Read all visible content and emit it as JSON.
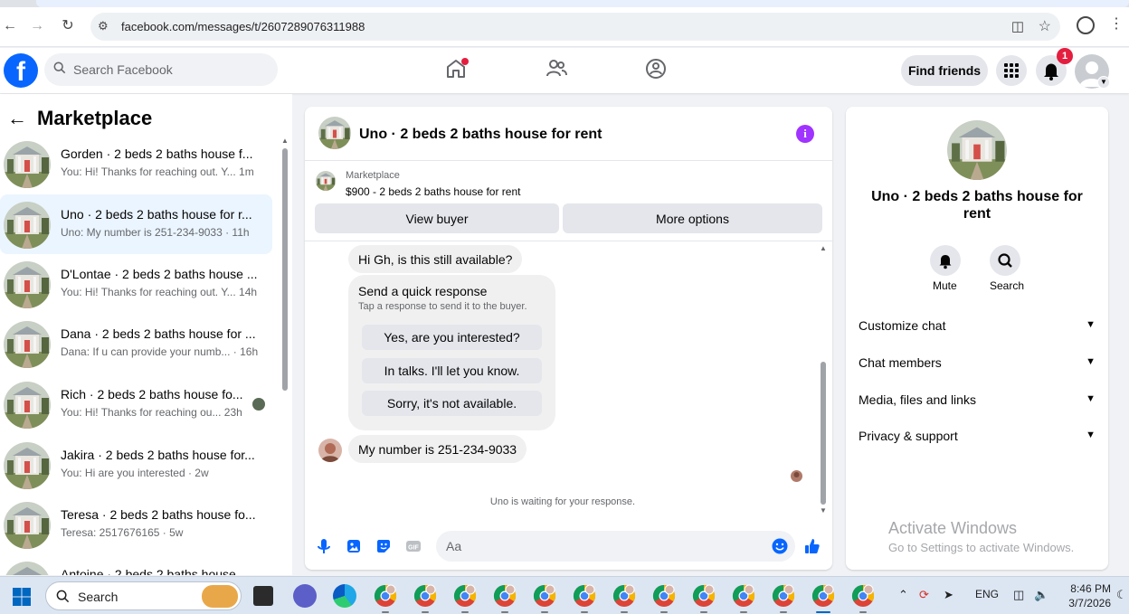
{
  "browser": {
    "url": "facebook.com/messages/t/2607289076311988"
  },
  "header": {
    "logo_letter": "f",
    "search_placeholder": "Search Facebook",
    "find_friends_label": "Find friends",
    "notification_count": "1",
    "brand_color": "#0866ff"
  },
  "sidebar": {
    "title": "Marketplace",
    "conversations": [
      {
        "name": "Gorden · 2 beds 2 baths house f...",
        "snippet": "You: Hi! Thanks for reaching out. Y... 1m"
      },
      {
        "name": "Uno · 2 beds 2 baths house for r...",
        "snippet": "Uno: My number is 251-234-9033 · 11h"
      },
      {
        "name": "D'Lontae · 2 beds 2 baths house ...",
        "snippet": "You: Hi! Thanks for reaching out. Y... 14h"
      },
      {
        "name": "Dana · 2 beds 2 baths house for ...",
        "snippet": "Dana: If u can provide your numb... · 16h"
      },
      {
        "name": "Rich · 2 beds 2 baths house fo...",
        "snippet": "You: Hi! Thanks for reaching ou... 23h"
      },
      {
        "name": "Jakira · 2 beds 2 baths house for...",
        "snippet": "You: Hi are you interested · 2w"
      },
      {
        "name": "Teresa · 2 beds 2 baths house fo...",
        "snippet": "Teresa: 2517676165 · 5w"
      },
      {
        "name": "Antoine · 2 beds 2 baths house",
        "snippet": ""
      }
    ]
  },
  "chat": {
    "title": "Uno · 2 beds 2 baths house for rent",
    "listing_source": "Marketplace",
    "listing_price": "$900 - 2 beds 2 baths house for rent",
    "view_buyer_label": "View buyer",
    "more_options_label": "More options",
    "messages": {
      "first": "Hi Gh, is this still available?",
      "quick_title": "Send a quick response",
      "quick_sub": "Tap a response to send it to the buyer.",
      "quick_options": [
        "Yes, are you interested?",
        "In talks. I'll let you know.",
        "Sorry, it's not available."
      ],
      "reply": "My number is 251-234-9033"
    },
    "waiting_text": "Uno is waiting for your response.",
    "composer_placeholder": "Aa"
  },
  "details": {
    "title": "Uno · 2 beds 2 baths house for rent",
    "mute_label": "Mute",
    "search_label": "Search",
    "sections": [
      "Customize chat",
      "Chat members",
      "Media, files and links",
      "Privacy & support"
    ]
  },
  "watermark": {
    "line1": "Activate Windows",
    "line2": "Go to Settings to activate Windows."
  },
  "taskbar": {
    "search_label": "Search",
    "language": "ENG",
    "time": "8:46 PM",
    "date": "3/7/2026"
  }
}
